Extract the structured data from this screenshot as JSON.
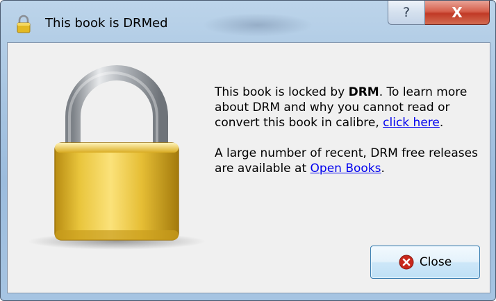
{
  "window": {
    "title": "This book is DRMed",
    "help_glyph": "?",
    "close_glyph": "X"
  },
  "message": {
    "p1_a": "This book is locked by ",
    "p1_bold": "DRM",
    "p1_b": ". To learn more about DRM and why you cannot read or convert this book in calibre, ",
    "p1_link": "click here",
    "p1_c": ".",
    "p2_a": "A large number of recent, DRM free releases are available at ",
    "p2_link": "Open Books",
    "p2_c": "."
  },
  "buttons": {
    "close_label": "Close"
  },
  "icons": {
    "title": "padlock-icon",
    "art": "padlock-illustration",
    "help": "help-icon",
    "window_close": "close-icon",
    "button_close": "error-x-icon"
  },
  "colors": {
    "link": "#0000ee",
    "close_red": "#c13a26",
    "lock_gold": "#e8c63a"
  }
}
